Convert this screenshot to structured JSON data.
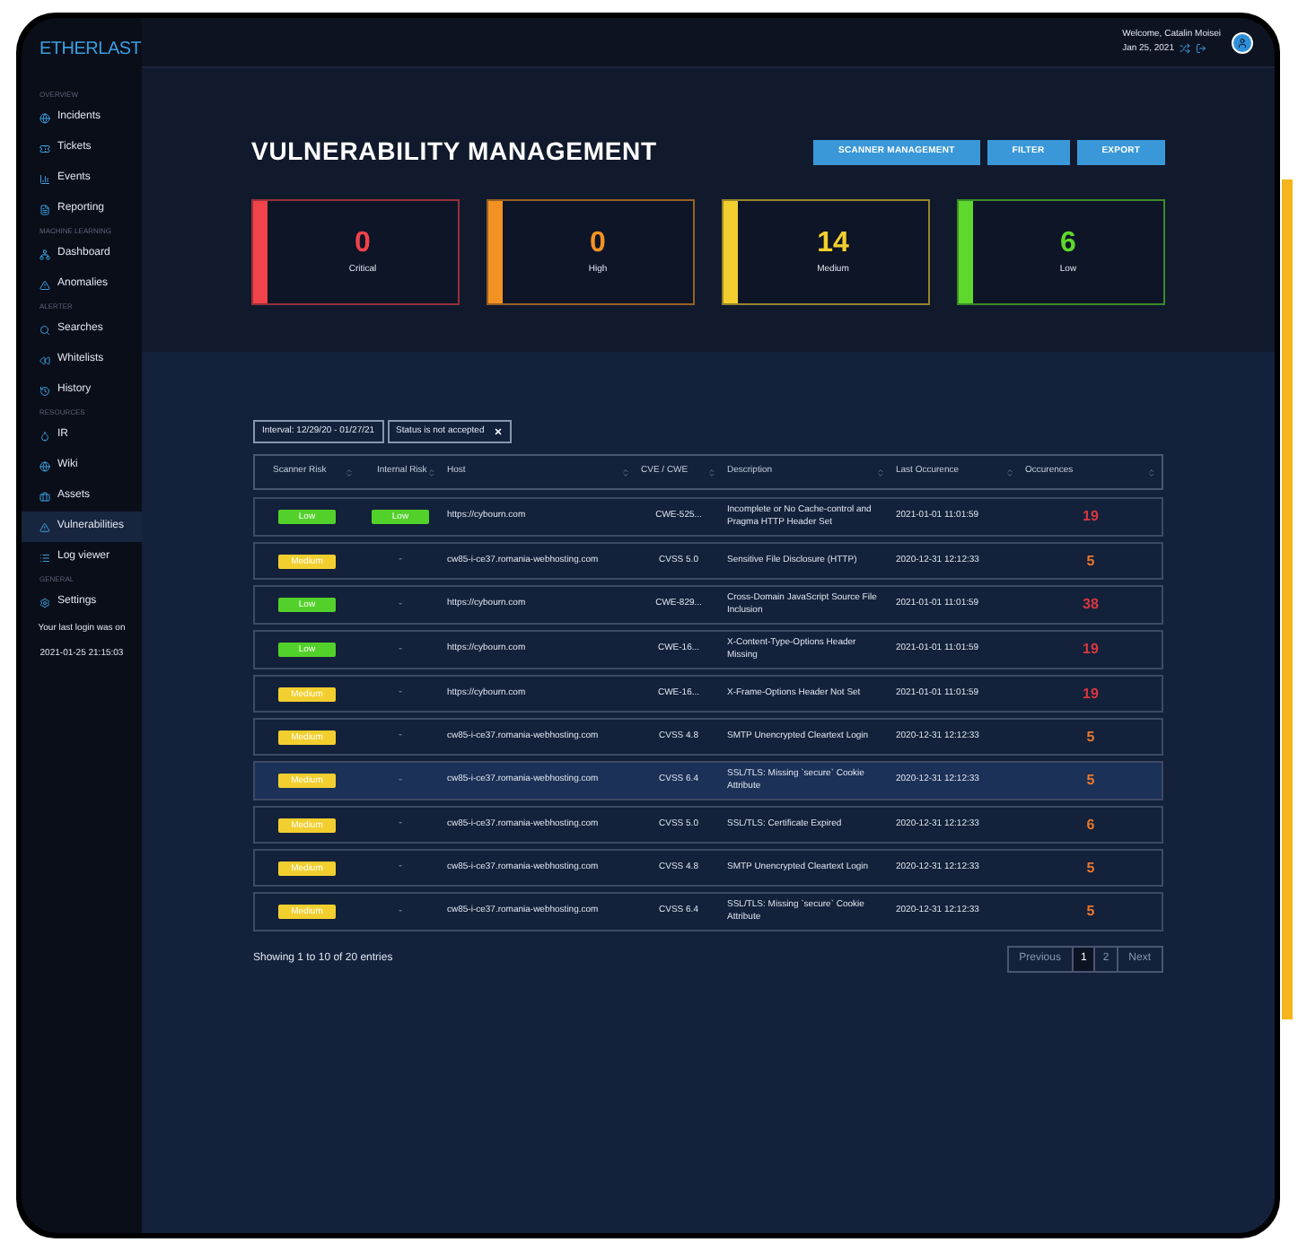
{
  "brand": "ETHERLAST",
  "sidebar": {
    "sections": [
      {
        "heading": "OVERVIEW",
        "items": [
          {
            "label": "Incidents",
            "selected": false
          },
          {
            "label": "Tickets",
            "selected": false
          },
          {
            "label": "Events",
            "selected": false
          },
          {
            "label": "Reporting",
            "selected": false
          }
        ]
      },
      {
        "heading": "MACHINE LEARNING",
        "items": [
          {
            "label": "Dashboard",
            "selected": false
          },
          {
            "label": "Anomalies",
            "selected": false
          }
        ]
      },
      {
        "heading": "ALERTER",
        "items": [
          {
            "label": "Searches",
            "selected": false
          },
          {
            "label": "Whitelists",
            "selected": false
          },
          {
            "label": "History",
            "selected": false
          }
        ]
      },
      {
        "heading": "RESOURCES",
        "items": [
          {
            "label": "IR",
            "selected": false
          },
          {
            "label": "Wiki",
            "selected": false
          },
          {
            "label": "Assets",
            "selected": false
          },
          {
            "label": "Vulnerabilities",
            "selected": true
          },
          {
            "label": "Log viewer",
            "selected": false
          }
        ]
      },
      {
        "heading": "GENERAL",
        "items": [
          {
            "label": "Settings",
            "selected": false
          }
        ]
      }
    ],
    "last_login_label": "Your last login was on",
    "last_login": "2021-01-25 21:15:03"
  },
  "header": {
    "welcome": "Welcome, Catalin Moisei",
    "date": "Jan 25, 2021"
  },
  "page_title": "VULNERABILITY MANAGEMENT",
  "actions": [
    "SCANNER MANAGEMENT",
    "FILTER",
    "EXPORT"
  ],
  "summary": [
    {
      "value": "0",
      "label": "Critical",
      "color": "#f2434a"
    },
    {
      "value": "0",
      "label": "High",
      "color": "#f39224"
    },
    {
      "value": "14",
      "label": "Medium",
      "color": "#f2cf2e"
    },
    {
      "value": "6",
      "label": "Low",
      "color": "#5ed82c"
    }
  ],
  "filters": [
    {
      "label": "Interval: 12/29/20 - 01/27/21",
      "removable": false
    },
    {
      "label": "Status is not accepted",
      "removable": true
    }
  ],
  "table": {
    "columns": [
      "Scanner Risk",
      "Internal Risk",
      "Host",
      "CVE / CWE",
      "Description",
      "Last Occurence",
      "Occurences"
    ],
    "rows": [
      {
        "scanner_risk": "Low",
        "internal_risk": "Low",
        "host": "https://cybourn.com",
        "cve": "CWE-525...",
        "description": "Incomplete or No Cache-control and Pragma HTTP Header Set",
        "last": "2021-01-01 11:01:59",
        "count": "19",
        "color": "#d9363e",
        "selected": false
      },
      {
        "scanner_risk": "Medium",
        "internal_risk": "-",
        "host": "cw85-i-ce37.romania-webhosting.com",
        "cve": "CVSS 5.0",
        "description": "Sensitive File Disclosure (HTTP)",
        "last": "2020-12-31 12:12:33",
        "count": "5",
        "color": "#e8762b",
        "selected": false
      },
      {
        "scanner_risk": "Low",
        "internal_risk": "-",
        "host": "https://cybourn.com",
        "cve": "CWE-829...",
        "description": "Cross-Domain JavaScript Source File Inclusion",
        "last": "2021-01-01 11:01:59",
        "count": "38",
        "color": "#d9363e",
        "selected": false
      },
      {
        "scanner_risk": "Low",
        "internal_risk": "-",
        "host": "https://cybourn.com",
        "cve": "CWE-16...",
        "description": "X-Content-Type-Options Header Missing",
        "last": "2021-01-01 11:01:59",
        "count": "19",
        "color": "#d9363e",
        "selected": false
      },
      {
        "scanner_risk": "Medium",
        "internal_risk": "-",
        "host": "https://cybourn.com",
        "cve": "CWE-16...",
        "description": "X-Frame-Options Header Not Set",
        "last": "2021-01-01 11:01:59",
        "count": "19",
        "color": "#d9363e",
        "selected": false
      },
      {
        "scanner_risk": "Medium",
        "internal_risk": "-",
        "host": "cw85-i-ce37.romania-webhosting.com",
        "cve": "CVSS 4.8",
        "description": "SMTP Unencrypted Cleartext Login",
        "last": "2020-12-31 12:12:33",
        "count": "5",
        "color": "#e8762b",
        "selected": false
      },
      {
        "scanner_risk": "Medium",
        "internal_risk": "-",
        "host": "cw85-i-ce37.romania-webhosting.com",
        "cve": "CVSS 6.4",
        "description": "SSL/TLS: Missing `secure` Cookie Attribute",
        "last": "2020-12-31 12:12:33",
        "count": "5",
        "color": "#e8762b",
        "selected": true
      },
      {
        "scanner_risk": "Medium",
        "internal_risk": "-",
        "host": "cw85-i-ce37.romania-webhosting.com",
        "cve": "CVSS 5.0",
        "description": "SSL/TLS: Certificate Expired",
        "last": "2020-12-31 12:12:33",
        "count": "6",
        "color": "#e8762b",
        "selected": false
      },
      {
        "scanner_risk": "Medium",
        "internal_risk": "-",
        "host": "cw85-i-ce37.romania-webhosting.com",
        "cve": "CVSS 4.8",
        "description": "SMTP Unencrypted Cleartext Login",
        "last": "2020-12-31 12:12:33",
        "count": "5",
        "color": "#e8762b",
        "selected": false
      },
      {
        "scanner_risk": "Medium",
        "internal_risk": "-",
        "host": "cw85-i-ce37.romania-webhosting.com",
        "cve": "CVSS 6.4",
        "description": "SSL/TLS: Missing `secure` Cookie Attribute",
        "last": "2020-12-31 12:12:33",
        "count": "5",
        "color": "#e8762b",
        "selected": false
      }
    ]
  },
  "entries_info": "Showing 1 to 10 of 20 entries",
  "pagination": [
    {
      "label": "Previous",
      "kind": "nav",
      "selected": false
    },
    {
      "label": "1",
      "kind": "page",
      "selected": true
    },
    {
      "label": "2",
      "kind": "page",
      "selected": false
    },
    {
      "label": "Next",
      "kind": "nav",
      "selected": false
    }
  ]
}
